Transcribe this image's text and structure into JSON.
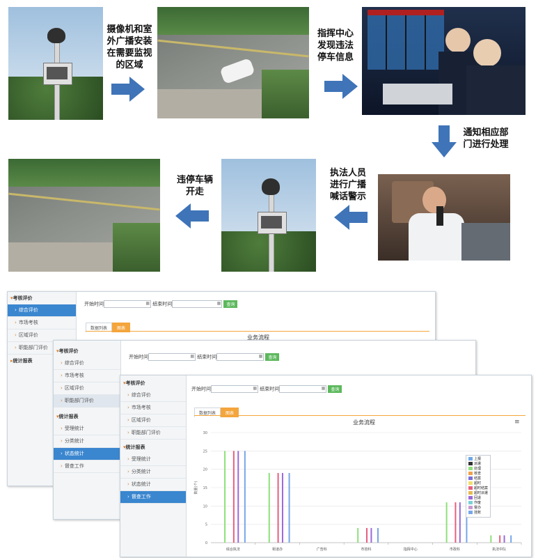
{
  "flow": {
    "step1": "摄像机和室外广播安装在需要监视的区域",
    "step2": "指挥中心发现违法停车信息",
    "step3": "通知相应部门进行处理",
    "step4": "执法人员进行广播喊话警示",
    "step5": "违停车辆开走"
  },
  "back_window": {
    "sidebar": {
      "group1": "考核评价",
      "items": [
        "综合评价",
        "市场考核",
        "区域评价",
        "职能部门评价"
      ],
      "group2": "统计报表"
    },
    "filter": {
      "start_label": "开始时间",
      "end_label": "结束时间",
      "query": "查询"
    },
    "tabs": [
      "数据列表",
      "图表"
    ],
    "chart_title": "业务流程"
  },
  "mid_window": {
    "sidebar": {
      "group1": "考核评价",
      "items": [
        "综合评价",
        "市场考核",
        "区域评价",
        "职能部门评价"
      ],
      "group2": "统计报表",
      "items2": [
        "受理统计",
        "分类统计",
        "状态统计",
        "督查工作"
      ]
    },
    "filter": {
      "start_label": "开始时间",
      "end_label": "结束时间",
      "query": "查询"
    }
  },
  "front_window": {
    "sidebar": {
      "group1": "考核评价",
      "items": [
        "综合评价",
        "市场考核",
        "区域评价",
        "职能部门评价"
      ],
      "group2": "统计报表",
      "items2": [
        "受理统计",
        "分类统计",
        "状态统计",
        "督查工作"
      ]
    },
    "filter": {
      "start_label": "开始时间",
      "end_label": "结束时间",
      "query": "查询"
    },
    "tabs": [
      "数据列表",
      "图表"
    ]
  },
  "chart_data": {
    "type": "bar",
    "title": "业务流程",
    "ylabel": "数量(个)",
    "ylim": [
      0,
      30
    ],
    "yticks": [
      0,
      5,
      10,
      15,
      20,
      25,
      30
    ],
    "categories": [
      "综合执法",
      "街道办",
      "广告科",
      "市容科",
      "指挥中心",
      "市政科",
      "执法中队"
    ],
    "series": [
      {
        "name": "上报",
        "color": "#6fa8e8",
        "values": [
          0,
          0,
          0,
          0,
          0,
          0,
          0
        ]
      },
      {
        "name": "派遣",
        "color": "#333333",
        "values": [
          0,
          0,
          0,
          0,
          0,
          0,
          0
        ]
      },
      {
        "name": "处理",
        "color": "#8ee07a",
        "values": [
          25,
          19,
          0,
          4,
          0,
          11,
          2
        ]
      },
      {
        "name": "核查",
        "color": "#f1a04a",
        "values": [
          0,
          0,
          0,
          0,
          0,
          0,
          0
        ]
      },
      {
        "name": "结案",
        "color": "#7b6fd8",
        "values": [
          0,
          0,
          0,
          0,
          0,
          0,
          0
        ]
      },
      {
        "name": "超时",
        "color": "#f0df6a",
        "values": [
          0,
          0,
          0,
          0,
          0,
          0,
          0
        ]
      },
      {
        "name": "超时结案",
        "color": "#e65f7e",
        "values": [
          25,
          19,
          0,
          4,
          0,
          11,
          2
        ]
      },
      {
        "name": "超时派遣",
        "color": "#e6b94d",
        "values": [
          0,
          0,
          0,
          0,
          0,
          0,
          0
        ]
      },
      {
        "name": "回退",
        "color": "#9b6ad8",
        "values": [
          25,
          19,
          0,
          4,
          0,
          11,
          2
        ]
      },
      {
        "name": "作废",
        "color": "#7ad0d8",
        "values": [
          0,
          0,
          0,
          0,
          0,
          0,
          0
        ]
      },
      {
        "name": "督办",
        "color": "#c89ad0",
        "values": [
          0,
          0,
          0,
          0,
          0,
          0,
          0
        ]
      },
      {
        "name": "挂账",
        "color": "#78a6e8",
        "values": [
          25,
          19,
          0,
          4,
          0,
          11,
          2
        ]
      }
    ]
  }
}
